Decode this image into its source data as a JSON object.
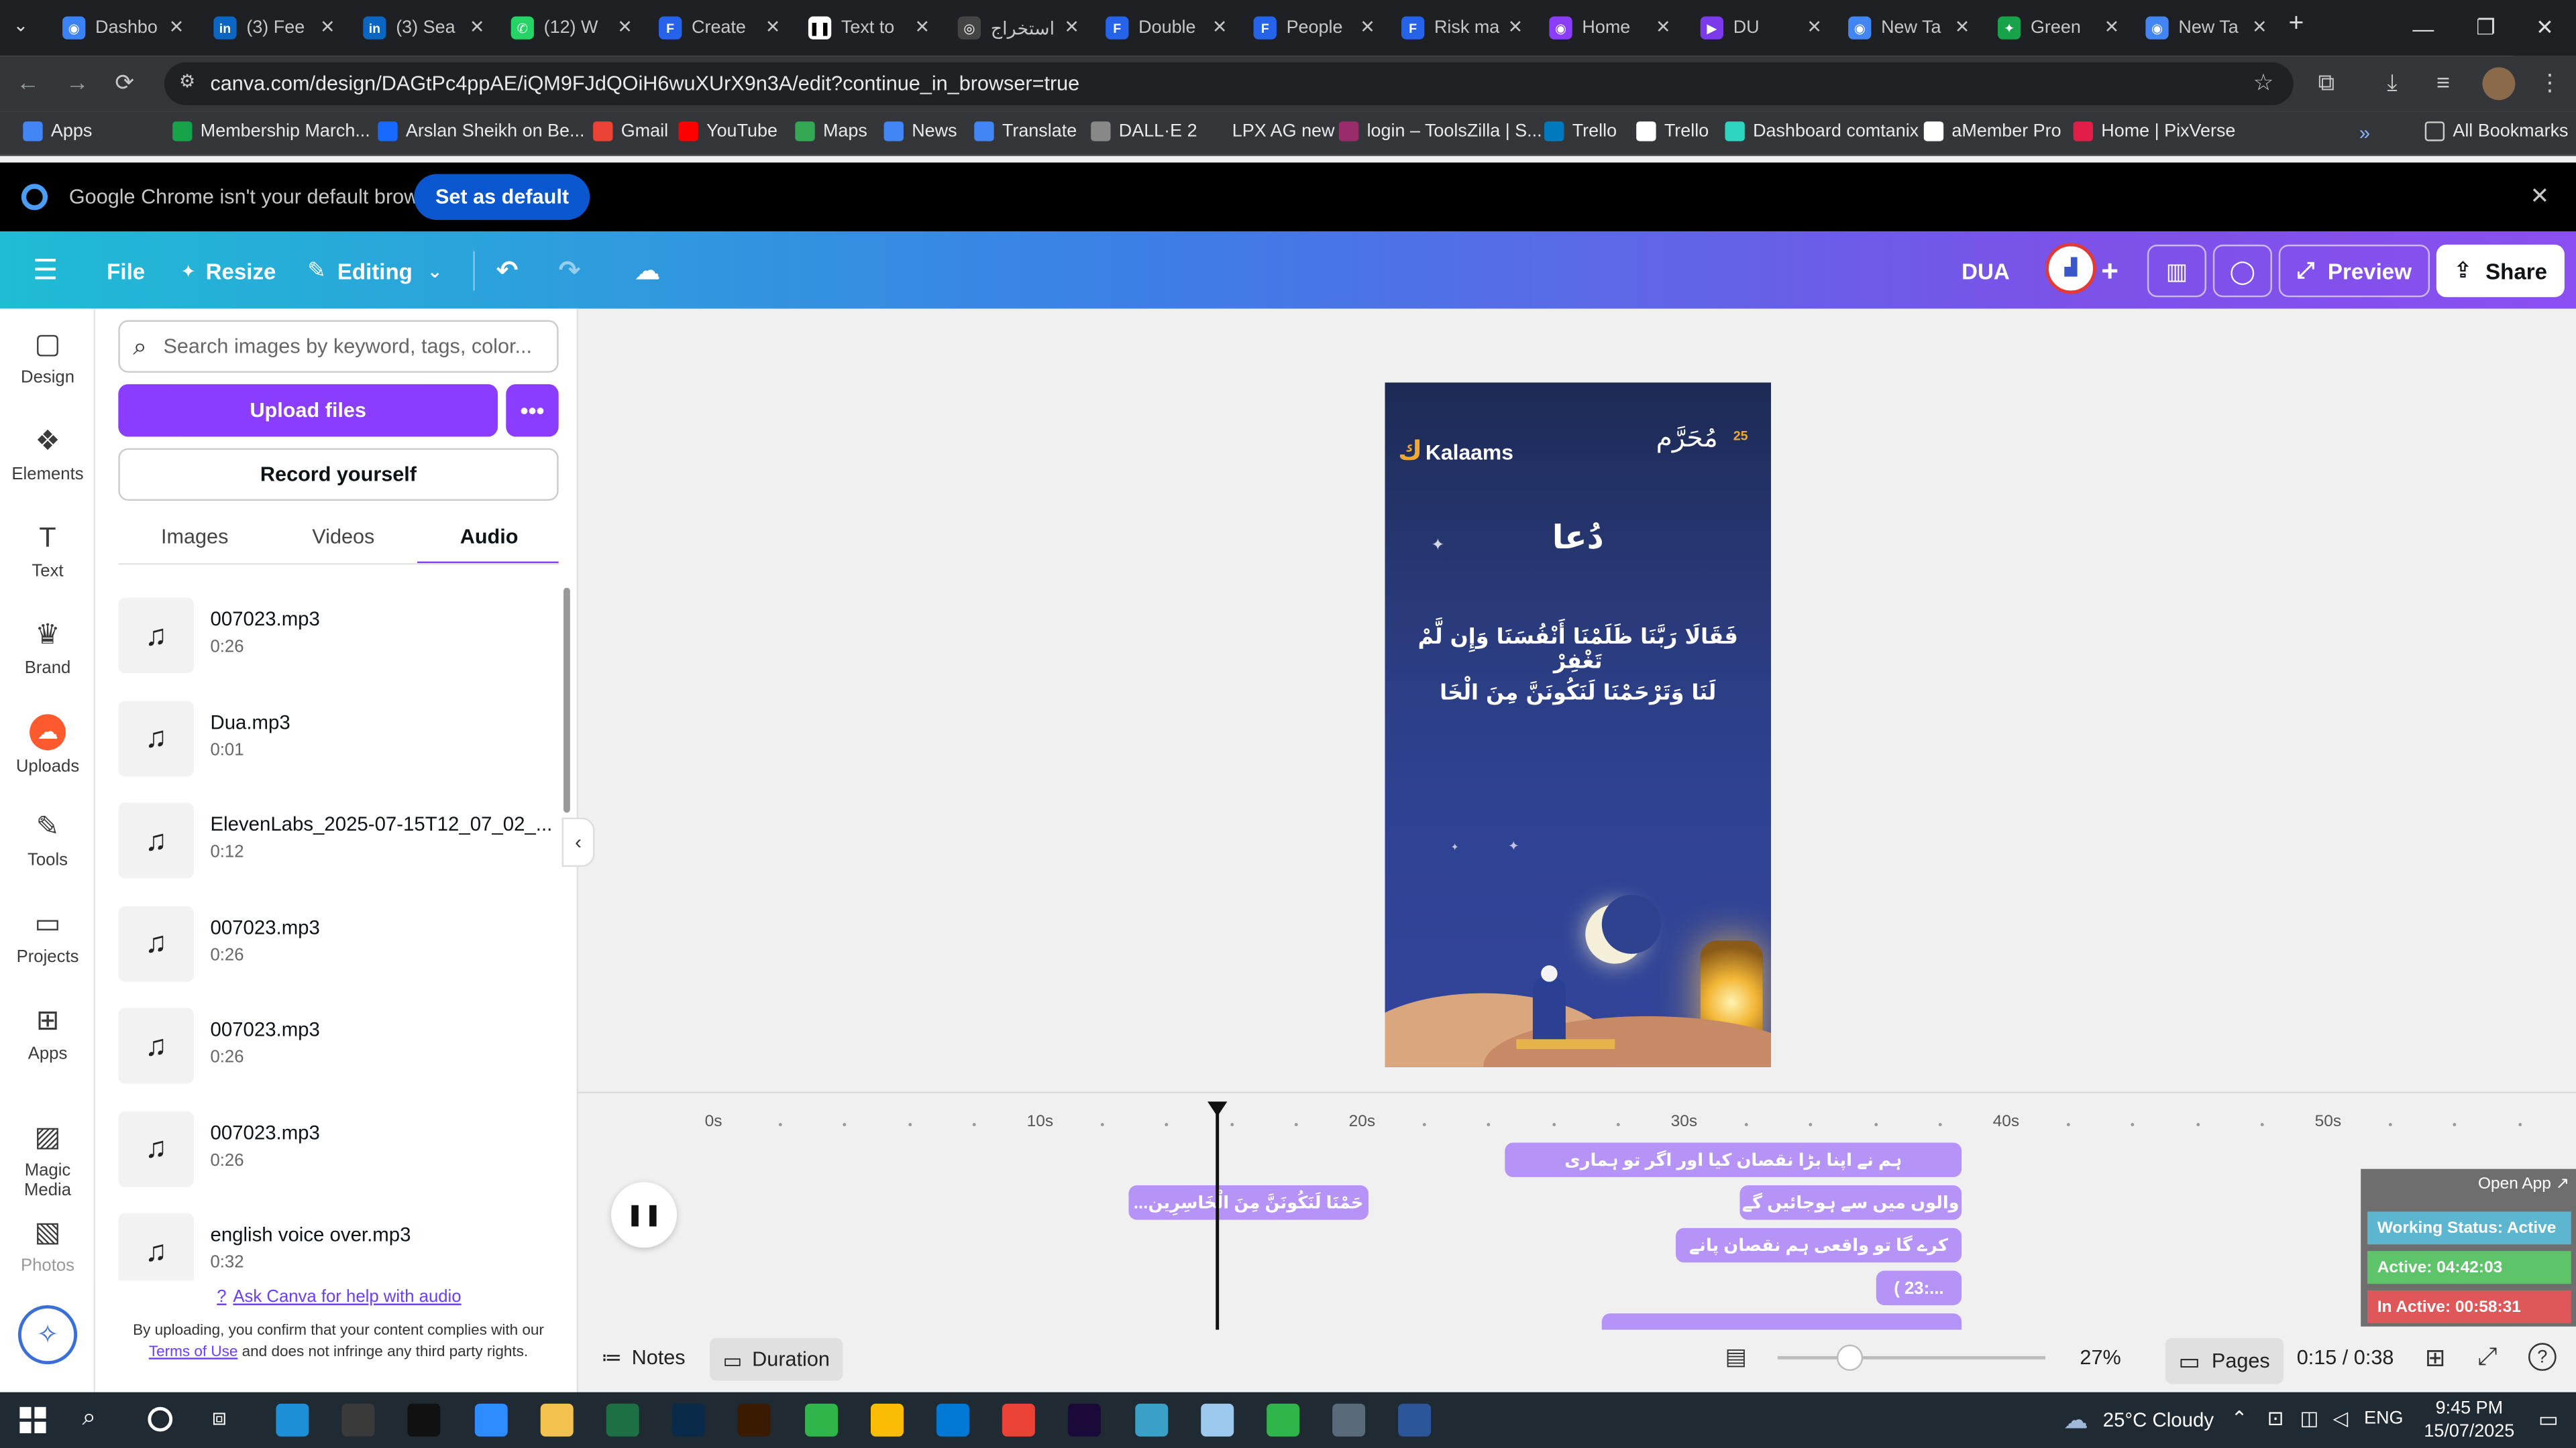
{
  "browser": {
    "tabs": [
      {
        "label": "Dashbo",
        "color": "#3b82f6",
        "glyph": "◉"
      },
      {
        "label": "(3) Fee",
        "color": "#0a66c2",
        "glyph": "in"
      },
      {
        "label": "(3) Sea",
        "color": "#0a66c2",
        "glyph": "in"
      },
      {
        "label": "(12) W",
        "color": "#25d366",
        "glyph": "✆"
      },
      {
        "label": "Create",
        "color": "#2563eb",
        "glyph": "F"
      },
      {
        "label": "Text to",
        "color": "#ffffff",
        "glyph": "❚❚"
      },
      {
        "label": "استخراج",
        "color": "#444444",
        "glyph": "◎"
      },
      {
        "label": "Double",
        "color": "#2563eb",
        "glyph": "F"
      },
      {
        "label": "People",
        "color": "#2563eb",
        "glyph": "F"
      },
      {
        "label": "Risk ma",
        "color": "#2563eb",
        "glyph": "F"
      },
      {
        "label": "Home",
        "color": "#8b3dff",
        "glyph": "◉"
      },
      {
        "label": "DU",
        "color": "#7c3aed",
        "glyph": "▶"
      },
      {
        "label": "New Ta",
        "color": "#4285f4",
        "glyph": "◉"
      },
      {
        "label": "Green",
        "color": "#16a34a",
        "glyph": "✦"
      },
      {
        "label": "New Ta",
        "color": "#4285f4",
        "glyph": "◉"
      }
    ],
    "url": "canva.com/design/DAGtPc4ppAE/iQM9FJdQOiH6wuXUrX9n3A/edit?continue_in_browser=true",
    "bookmarks": [
      {
        "label": "Apps",
        "color": "#4285f4"
      },
      {
        "label": "Membership March...",
        "color": "#16a34a"
      },
      {
        "label": "Arslan Sheikh on Be...",
        "color": "#1769ff"
      },
      {
        "label": "Gmail",
        "color": "#ea4335"
      },
      {
        "label": "YouTube",
        "color": "#ff0000"
      },
      {
        "label": "Maps",
        "color": "#34a853"
      },
      {
        "label": "News",
        "color": "#4285f4"
      },
      {
        "label": "Translate",
        "color": "#4285f4"
      },
      {
        "label": "DALL·E 2",
        "color": "#888888"
      },
      {
        "label": "LPX AG new",
        "color": "#35363a"
      },
      {
        "label": "login – ToolsZilla | S...",
        "color": "#9b2c6b"
      },
      {
        "label": "Trello",
        "color": "#0079bf"
      },
      {
        "label": "Trello",
        "color": "#ffffff"
      },
      {
        "label": "Dashboard comtanix",
        "color": "#2dd4bf"
      },
      {
        "label": "aMember Pro",
        "color": "#ffffff"
      },
      {
        "label": "Home | PixVerse",
        "color": "#e11d48"
      }
    ],
    "all_bookmarks": "All Bookmarks",
    "infobar_text": "Google Chrome isn't your default browser",
    "set_default": "Set as default"
  },
  "canva": {
    "header": {
      "file": "File",
      "resize": "Resize",
      "editing": "Editing",
      "title": "DUA",
      "preview": "Preview",
      "share": "Share"
    },
    "rail": [
      {
        "label": "Design",
        "icon": "▢"
      },
      {
        "label": "Elements",
        "icon": "❖"
      },
      {
        "label": "Text",
        "icon": "T"
      },
      {
        "label": "Brand",
        "icon": "♛"
      },
      {
        "label": "Uploads",
        "icon": "☁"
      },
      {
        "label": "Tools",
        "icon": "✎"
      },
      {
        "label": "Projects",
        "icon": "▭"
      },
      {
        "label": "Apps",
        "icon": "⊞"
      },
      {
        "label": "Magic Media",
        "icon": "▨"
      },
      {
        "label": "Photos",
        "icon": "▧"
      }
    ],
    "panel": {
      "search_placeholder": "Search images by keyword, tags, color...",
      "upload": "Upload files",
      "record": "Record yourself",
      "tabs": [
        "Images",
        "Videos",
        "Audio"
      ],
      "audio": [
        {
          "name": "007023.mp3",
          "duration": "0:26"
        },
        {
          "name": "Dua.mp3",
          "duration": "0:01"
        },
        {
          "name": "ElevenLabs_2025-07-15T12_07_02_...",
          "duration": "0:12"
        },
        {
          "name": "007023.mp3",
          "duration": "0:26"
        },
        {
          "name": "007023.mp3",
          "duration": "0:26"
        },
        {
          "name": "007023.mp3",
          "duration": "0:26"
        },
        {
          "name": "english voice over.mp3",
          "duration": "0:32"
        }
      ],
      "help": "Ask Canva for help with audio",
      "terms_pre": "By uploading, you confirm that your content complies with our",
      "terms_link": "Terms of Use",
      "terms_post": "and does not infringe any third party rights."
    },
    "design": {
      "brand": "Kalaams",
      "title": "دُعا",
      "arabic_line1": "فَقَالَا رَبَّنَا ظَلَمْنَا أَنْفُسَنَا وَإِن لَّمْ تَغْفِرْ",
      "arabic_line2": "لَنَا وَتَرْحَمْنَا لَنَكُونَنَّ مِنَ الْخَا",
      "badge_text": "مُحَرَّم",
      "badge_num": "25"
    },
    "timeline": {
      "ticks": [
        "0s",
        "10s",
        "20s",
        "30s",
        "40s",
        "50s"
      ],
      "captions": [
        "ہم نے اپنا بڑا نقصان کیا اور اگر تو ہماری",
        "...حَمْنَا لَنَكُونَنَّ مِنَ الْخَاسِرِين",
        "والوں میں سے ہوجائیں گے",
        "کرے گا تو واقعی ہم نقصان پانے",
        "( 23:..."
      ]
    },
    "bottom": {
      "notes": "Notes",
      "duration": "Duration",
      "zoom": "27%",
      "pages": "Pages",
      "time": "0:15 / 0:38"
    }
  },
  "overlay": {
    "open_app": "Open App ↗",
    "status": "Working Status: Active",
    "active": "Active: 04:42:03",
    "inactive": "In Active: 00:58:31"
  },
  "taskbar": {
    "weather": "25°C Cloudy",
    "lang": "ENG",
    "time": "9:45 PM",
    "date": "15/07/2025"
  }
}
